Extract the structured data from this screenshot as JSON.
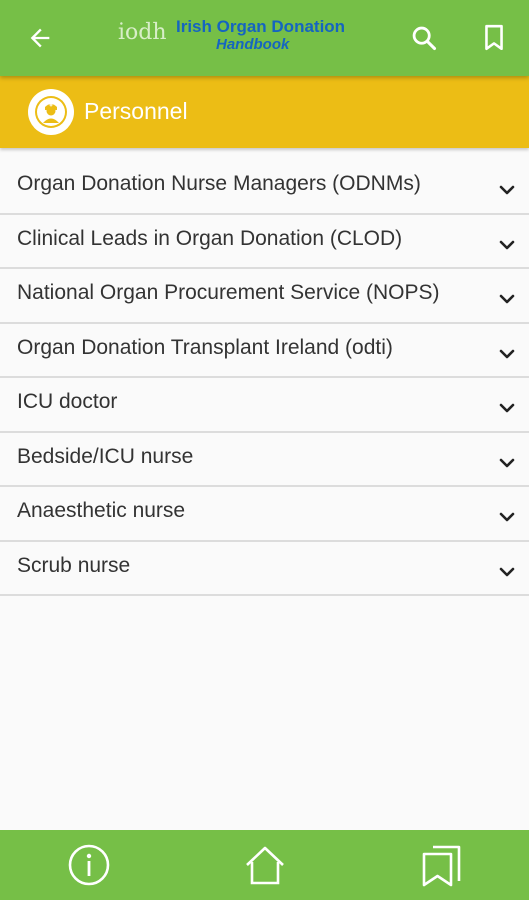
{
  "colors": {
    "appbar": "#76bf47",
    "section_header": "#ecbd15",
    "logo_text": "#1565c0"
  },
  "appbar": {
    "back_icon": "arrow-left-icon",
    "logo_mark": "iodh",
    "logo_title_line1": "Irish Organ Donation",
    "logo_title_line2": "Handbook",
    "search_icon": "search-icon",
    "bookmark_icon": "bookmark-icon"
  },
  "section": {
    "icon": "nurse-icon",
    "title": "Personnel"
  },
  "items": [
    {
      "label": "Organ Donation Nurse Managers (ODNMs)"
    },
    {
      "label": "Clinical Leads in Organ Donation (CLOD)"
    },
    {
      "label": "National Organ Procurement Service (NOPS)"
    },
    {
      "label": "Organ Donation Transplant Ireland (odti)"
    },
    {
      "label": "ICU doctor"
    },
    {
      "label": "Bedside/ICU nurse"
    },
    {
      "label": "Anaesthetic nurse"
    },
    {
      "label": "Scrub nurse"
    }
  ],
  "bottom_nav": {
    "info_icon": "info-icon",
    "home_icon": "home-icon",
    "bookmarks_icon": "bookmarks-icon"
  }
}
